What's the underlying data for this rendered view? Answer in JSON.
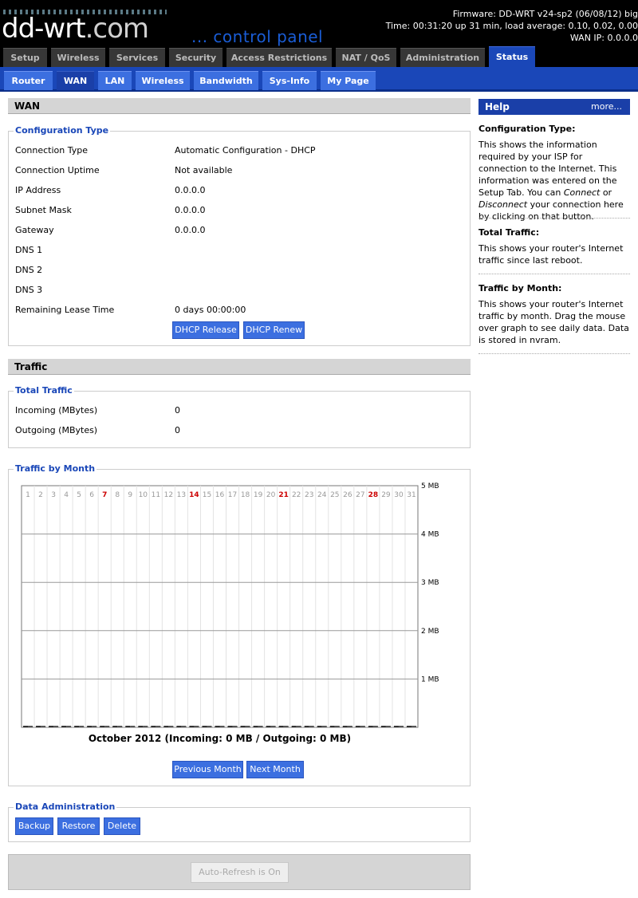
{
  "header": {
    "logo_main": "dd-wrt",
    "logo_com": ".com",
    "subtitle": "... control panel",
    "firmware": "Firmware: DD-WRT v24-sp2 (06/08/12) big",
    "time": "Time: 00:31:20 up 31 min, load average: 0.10, 0.02, 0.00",
    "wan_ip": "WAN IP: 0.0.0.0"
  },
  "main_tabs": [
    "Setup",
    "Wireless",
    "Services",
    "Security",
    "Access Restrictions",
    "NAT / QoS",
    "Administration",
    "Status"
  ],
  "sub_tabs": [
    "Router",
    "WAN",
    "LAN",
    "Wireless",
    "Bandwidth",
    "Sys-Info",
    "My Page"
  ],
  "wan": {
    "title": "WAN",
    "config_legend": "Configuration Type",
    "rows": [
      {
        "label": "Connection Type",
        "value": "Automatic Configuration - DHCP"
      },
      {
        "label": "Connection Uptime",
        "value": "Not available"
      },
      {
        "label": "IP Address",
        "value": "0.0.0.0"
      },
      {
        "label": "Subnet Mask",
        "value": "0.0.0.0"
      },
      {
        "label": "Gateway",
        "value": "0.0.0.0"
      },
      {
        "label": "DNS 1",
        "value": ""
      },
      {
        "label": "DNS 2",
        "value": ""
      },
      {
        "label": "DNS 3",
        "value": ""
      },
      {
        "label": "Remaining Lease Time",
        "value": "0 days 00:00:00"
      }
    ],
    "release_label": "DHCP Release",
    "renew_label": "DHCP Renew"
  },
  "traffic": {
    "title": "Traffic",
    "total_legend": "Total Traffic",
    "incoming_label": "Incoming (MBytes)",
    "incoming_value": "0",
    "outgoing_label": "Outgoing (MBytes)",
    "outgoing_value": "0",
    "month_legend": "Traffic by Month",
    "caption": "October 2012 (Incoming: 0 MB / Outgoing: 0 MB)",
    "prev_label": "Previous Month",
    "next_label": "Next Month"
  },
  "chart_data": {
    "type": "bar",
    "title": "October 2012 (Incoming: 0 MB / Outgoing: 0 MB)",
    "categories": [
      "1",
      "2",
      "3",
      "4",
      "5",
      "6",
      "7",
      "8",
      "9",
      "10",
      "11",
      "12",
      "13",
      "14",
      "15",
      "16",
      "17",
      "18",
      "19",
      "20",
      "21",
      "22",
      "23",
      "24",
      "25",
      "26",
      "27",
      "28",
      "29",
      "30",
      "31"
    ],
    "highlighted_days": [
      "7",
      "14",
      "21",
      "28"
    ],
    "series": [
      {
        "name": "Incoming",
        "values": [
          0,
          0,
          0,
          0,
          0,
          0,
          0,
          0,
          0,
          0,
          0,
          0,
          0,
          0,
          0,
          0,
          0,
          0,
          0,
          0,
          0,
          0,
          0,
          0,
          0,
          0,
          0,
          0,
          0,
          0,
          0
        ]
      },
      {
        "name": "Outgoing",
        "values": [
          0,
          0,
          0,
          0,
          0,
          0,
          0,
          0,
          0,
          0,
          0,
          0,
          0,
          0,
          0,
          0,
          0,
          0,
          0,
          0,
          0,
          0,
          0,
          0,
          0,
          0,
          0,
          0,
          0,
          0,
          0
        ]
      }
    ],
    "y_ticks": [
      "5 MB",
      "4 MB",
      "3 MB",
      "2 MB",
      "1 MB"
    ],
    "ylim": [
      0,
      5
    ],
    "grid": true,
    "colors": {
      "highlight": "#cc0000",
      "normal": "#999999"
    }
  },
  "data_admin": {
    "legend": "Data Administration",
    "backup_label": "Backup",
    "restore_label": "Restore",
    "delete_label": "Delete"
  },
  "refresh_label": "Auto-Refresh is On",
  "help": {
    "title": "Help",
    "more_label": "more...",
    "sections": [
      {
        "title": "Configuration Type:",
        "text": "This shows the information required by your ISP for connection to the Internet. This information was entered on the Setup Tab. You can Connect or Disconnect your connection here by clicking on that button."
      },
      {
        "title": "Total Traffic:",
        "text": "This shows your router's Internet traffic since last reboot."
      },
      {
        "title": "Traffic by Month:",
        "text": "This shows your router's Internet traffic by month. Drag the mouse over graph to see daily data. Data is stored in nvram."
      }
    ]
  }
}
